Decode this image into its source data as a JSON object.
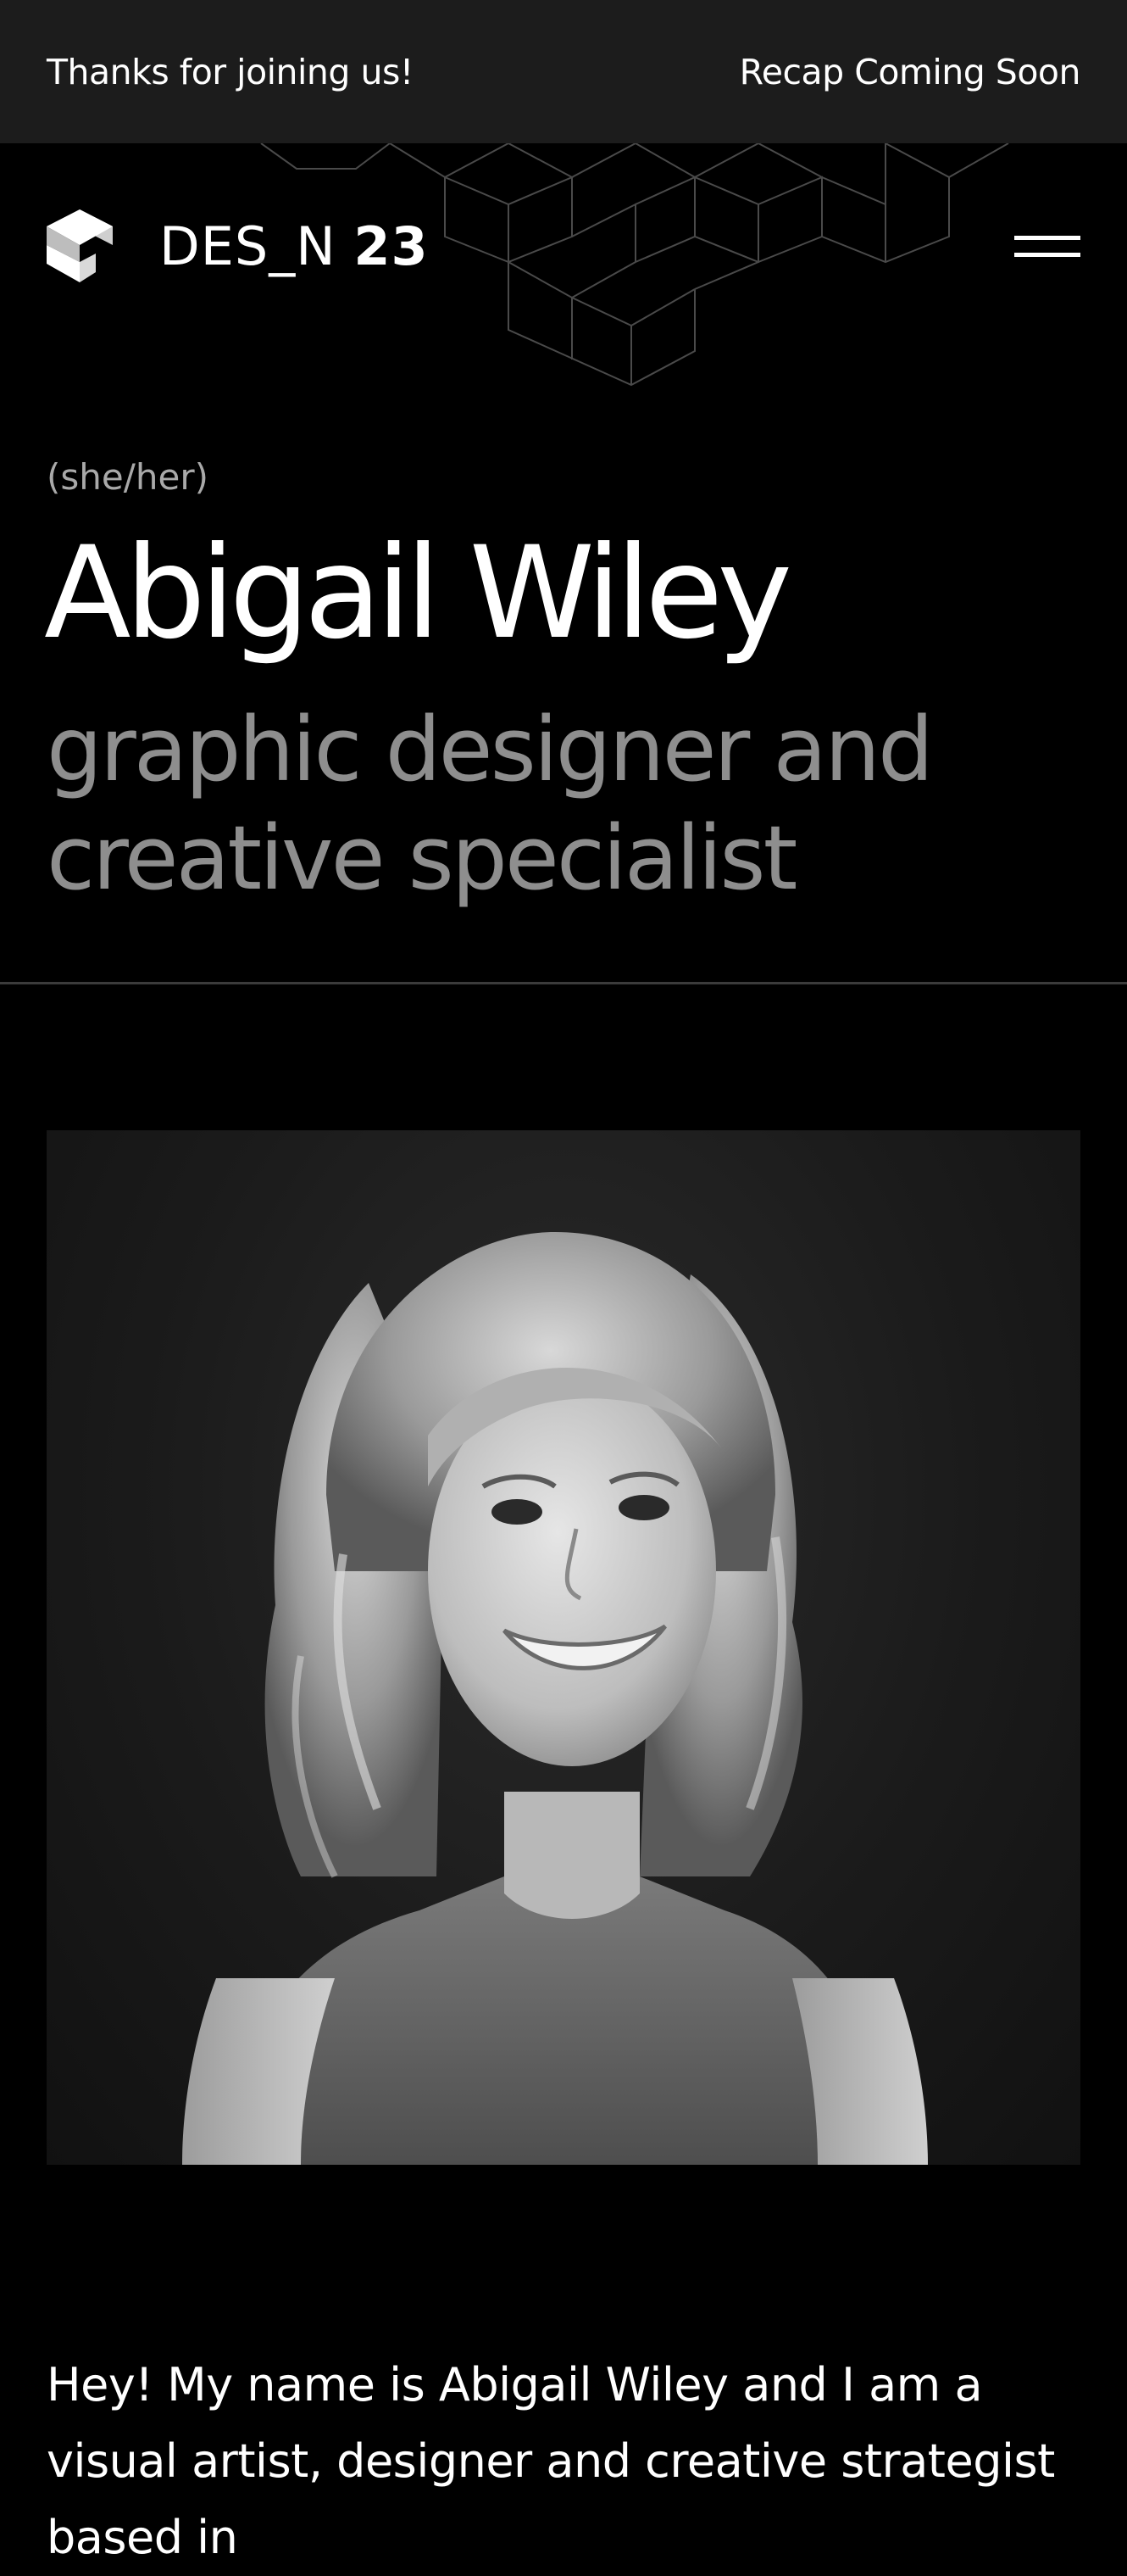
{
  "announcement": {
    "left_text": "Thanks for joining us!",
    "right_text": "Recap Coming Soon"
  },
  "header": {
    "brand_text": "DES_N",
    "brand_number": "23",
    "logo_icon": "isometric-cube-logo-icon",
    "menu_icon": "hamburger-menu-icon"
  },
  "profile": {
    "pronouns": "(she/her)",
    "name": "Abigail Wiley",
    "role": "graphic designer and creative specialist"
  },
  "bio": {
    "text": "Hey! My name is Abigail Wiley and I am a visual artist, designer and creative strategist based in"
  },
  "colors": {
    "background": "#000000",
    "announcement_bar": "#1c1c1c",
    "secondary_text": "#8e8e8e",
    "divider": "#3b3b3b"
  }
}
